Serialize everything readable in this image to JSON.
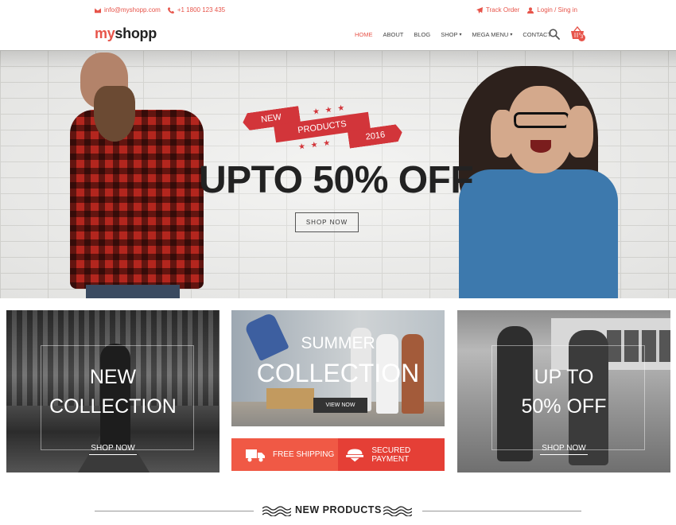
{
  "topbar": {
    "email": "info@myshopp.com",
    "phone": "+1 1800 123 435",
    "track_order": "Track Order",
    "login": "Login / Sing in"
  },
  "header": {
    "logo_part1": "my",
    "logo_part2": "shopp",
    "nav": [
      {
        "label": "HOME",
        "active": true
      },
      {
        "label": "ABOUT"
      },
      {
        "label": "BLOG"
      },
      {
        "label": "SHOP",
        "dropdown": true
      },
      {
        "label": "MEGA MENU",
        "dropdown": true
      },
      {
        "label": "CONTACT"
      }
    ],
    "cart_count": "3"
  },
  "hero": {
    "ribbon_new": "NEW",
    "ribbon_products": "PRODUCTS",
    "ribbon_year": "2016",
    "headline": "UPTO 50% OFF",
    "cta": "SHOP NOW"
  },
  "promos": {
    "new_collection": {
      "line1": "NEW",
      "line2": "COLLECTION",
      "link": "SHOP NOW"
    },
    "summer": {
      "line1": "SUMMER",
      "line2": "COLLECTION",
      "button": "VIEW NOW"
    },
    "upto": {
      "line1": "UP TO",
      "line2": "50% OFF",
      "link": "SHOP NOW"
    }
  },
  "features": {
    "shipping": "FREE SHIPPING",
    "payment": "SECURED PAYMENT"
  },
  "section": {
    "new_products": "NEW PRODUCTS"
  },
  "colors": {
    "accent": "#e7544a",
    "ribbon": "#d2353a",
    "shipping_bg": "#f05945",
    "payment_bg": "#e53f36"
  }
}
